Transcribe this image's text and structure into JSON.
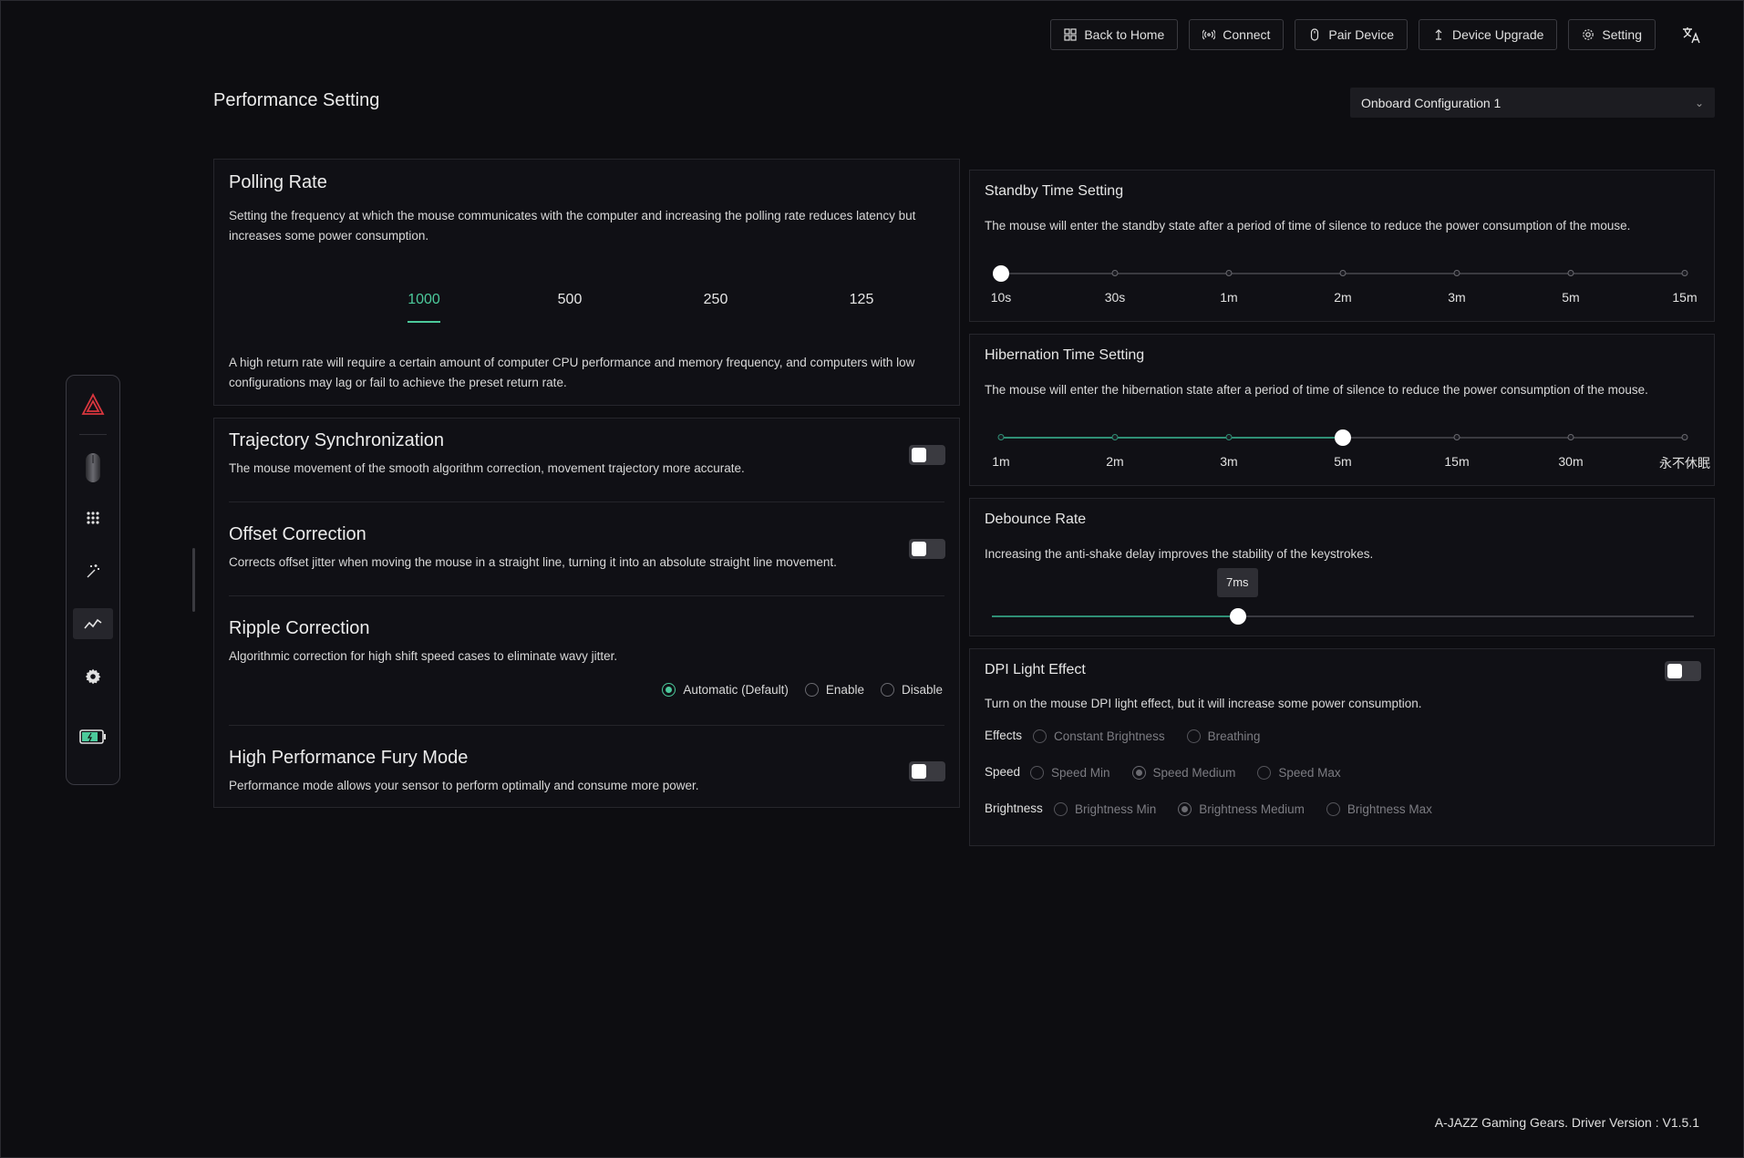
{
  "topbar": {
    "back_home": "Back to Home",
    "connect": "Connect",
    "pair_device": "Pair Device",
    "device_upgrade": "Device Upgrade",
    "setting": "Setting",
    "language_icon": "translate-icon"
  },
  "page": {
    "title": "Performance Setting",
    "config_select": "Onboard Configuration 1"
  },
  "sidebar": {
    "items": [
      "logo-icon",
      "mouse-icon",
      "keypad-grid-icon",
      "magic-wand-icon",
      "performance-chart-icon",
      "gear-icon",
      "battery-icon"
    ],
    "active": "performance-chart-icon"
  },
  "polling": {
    "title": "Polling Rate",
    "description": "Setting the frequency at which the mouse communicates with the computer and increasing the polling rate reduces latency but increases some power consumption.",
    "options": [
      "1000",
      "500",
      "250",
      "125"
    ],
    "selected": "1000",
    "note": "A high return rate will require a certain amount of computer CPU performance and memory frequency, and computers with low configurations may lag or fail to achieve the preset return rate."
  },
  "trajectory": {
    "title": "Trajectory Synchronization",
    "description": "The mouse movement of the smooth algorithm correction, movement trajectory more accurate.",
    "enabled": false
  },
  "offset": {
    "title": "Offset Correction",
    "description": "Corrects offset jitter when moving the mouse in a straight line, turning it into an absolute straight line movement.",
    "enabled": false
  },
  "ripple": {
    "title": "Ripple Correction",
    "description": "Algorithmic correction for high shift speed cases to eliminate wavy jitter.",
    "options": [
      "Automatic (Default)",
      "Enable",
      "Disable"
    ],
    "selected": "Automatic (Default)"
  },
  "fury": {
    "title": "High Performance Fury Mode",
    "description": "Performance mode allows your sensor to perform optimally and consume more power.",
    "enabled": false
  },
  "standby": {
    "title": "Standby Time Setting",
    "description": "The mouse will enter the standby state after a period of time of silence to reduce the power consumption of the mouse.",
    "labels": [
      "10s",
      "30s",
      "1m",
      "2m",
      "3m",
      "5m",
      "15m"
    ],
    "selected_index": 0
  },
  "hibernation": {
    "title": "Hibernation Time Setting",
    "description": "The mouse will enter the hibernation state after a period of time of silence to reduce the power consumption of the mouse.",
    "labels": [
      "1m",
      "2m",
      "3m",
      "5m",
      "15m",
      "30m",
      "永不休眠"
    ],
    "selected_index": 3
  },
  "debounce": {
    "title": "Debounce Rate",
    "description": "Increasing the anti-shake delay improves the stability of the keystrokes.",
    "value_label": "7ms",
    "fraction": 0.35
  },
  "dpi_light": {
    "title": "DPI Light Effect",
    "description": "Turn on the mouse DPI light effect, but it will increase some power consumption.",
    "enabled": false,
    "effects_label": "Effects",
    "effects": [
      "Constant Brightness",
      "Breathing"
    ],
    "speed_label": "Speed",
    "speeds": [
      "Speed Min",
      "Speed Medium",
      "Speed Max"
    ],
    "speed_selected": "Speed Medium",
    "brightness_label": "Brightness",
    "brightness": [
      "Brightness Min",
      "Brightness Medium",
      "Brightness Max"
    ],
    "brightness_selected": "Brightness Medium"
  },
  "footer": {
    "version": "A-JAZZ Gaming Gears. Driver Version : V1.5.1"
  },
  "colors": {
    "accent": "#4cc99b",
    "slider_fill": "#2f8f75",
    "background": "#0d0d11",
    "panel": "#101015",
    "logo": "#d9363e"
  }
}
